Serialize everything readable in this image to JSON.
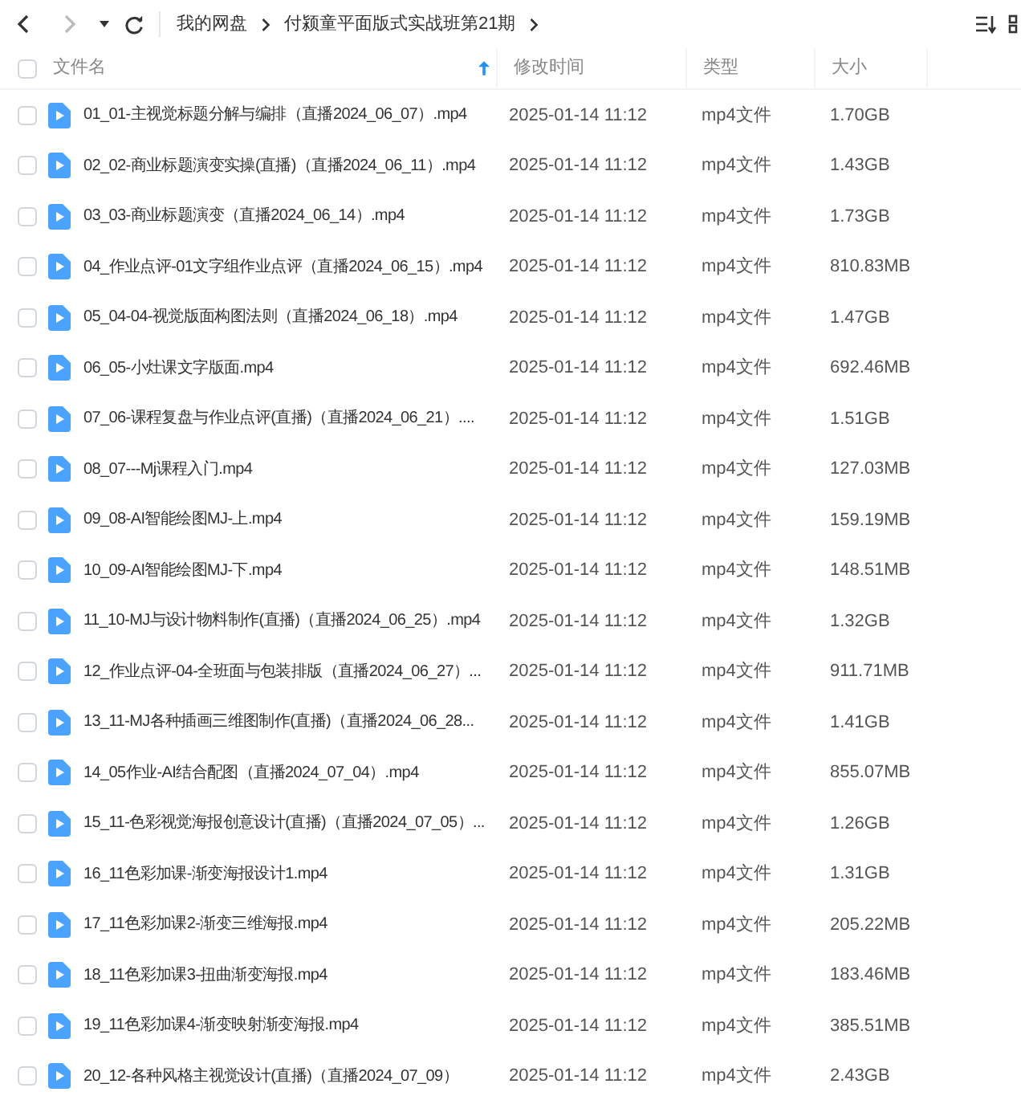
{
  "select_all": {
    "checked": false
  },
  "breadcrumb": [
    "我的网盘",
    "付颍童平面版式实战班第21期"
  ],
  "columns": [
    {
      "label": "文件名",
      "sorted": true
    },
    {
      "label": "修改时间",
      "sorted": false
    },
    {
      "label": "类型",
      "sorted": false
    },
    {
      "label": "大小",
      "sorted": false
    }
  ],
  "rows": [
    {
      "name": "01_01-主视觉标题分解与编排（直播2024_06_07）.mp4",
      "modified": "2025-01-14 11:12",
      "type": "mp4文件",
      "size": "1.70GB",
      "checked": false
    },
    {
      "name": "02_02-商业标题演变实操(直播)（直播2024_06_11）.mp4",
      "modified": "2025-01-14 11:12",
      "type": "mp4文件",
      "size": "1.43GB",
      "checked": false
    },
    {
      "name": "03_03-商业标题演变（直播2024_06_14）.mp4",
      "modified": "2025-01-14 11:12",
      "type": "mp4文件",
      "size": "1.73GB",
      "checked": false
    },
    {
      "name": "04_作业点评-01文字组作业点评（直播2024_06_15）.mp4",
      "modified": "2025-01-14 11:12",
      "type": "mp4文件",
      "size": "810.83MB",
      "checked": false
    },
    {
      "name": "05_04-04-视觉版面构图法则（直播2024_06_18）.mp4",
      "modified": "2025-01-14 11:12",
      "type": "mp4文件",
      "size": "1.47GB",
      "checked": false
    },
    {
      "name": "06_05-小灶课文字版面.mp4",
      "modified": "2025-01-14 11:12",
      "type": "mp4文件",
      "size": "692.46MB",
      "checked": false
    },
    {
      "name": "07_06-课程复盘与作业点评(直播)（直播2024_06_21）....",
      "modified": "2025-01-14 11:12",
      "type": "mp4文件",
      "size": "1.51GB",
      "checked": false
    },
    {
      "name": "08_07---Mj课程入门.mp4",
      "modified": "2025-01-14 11:12",
      "type": "mp4文件",
      "size": "127.03MB",
      "checked": false
    },
    {
      "name": "09_08-AI智能绘图MJ-上.mp4",
      "modified": "2025-01-14 11:12",
      "type": "mp4文件",
      "size": "159.19MB",
      "checked": false
    },
    {
      "name": "10_09-AI智能绘图MJ-下.mp4",
      "modified": "2025-01-14 11:12",
      "type": "mp4文件",
      "size": "148.51MB",
      "checked": false
    },
    {
      "name": "11_10-MJ与设计物料制作(直播)（直播2024_06_25）.mp4",
      "modified": "2025-01-14 11:12",
      "type": "mp4文件",
      "size": "1.32GB",
      "checked": false
    },
    {
      "name": "12_作业点评-04-全班面与包装排版（直播2024_06_27）...",
      "modified": "2025-01-14 11:12",
      "type": "mp4文件",
      "size": "911.71MB",
      "checked": false
    },
    {
      "name": "13_11-MJ各种插画三维图制作(直播)（直播2024_06_28...",
      "modified": "2025-01-14 11:12",
      "type": "mp4文件",
      "size": "1.41GB",
      "checked": false
    },
    {
      "name": "14_05作业-AI结合配图（直播2024_07_04）.mp4",
      "modified": "2025-01-14 11:12",
      "type": "mp4文件",
      "size": "855.07MB",
      "checked": false
    },
    {
      "name": "15_11-色彩视觉海报创意设计(直播)（直播2024_07_05）...",
      "modified": "2025-01-14 11:12",
      "type": "mp4文件",
      "size": "1.26GB",
      "checked": false
    },
    {
      "name": "16_11色彩加课-渐变海报设计1.mp4",
      "modified": "2025-01-14 11:12",
      "type": "mp4文件",
      "size": "1.31GB",
      "checked": false
    },
    {
      "name": "17_11色彩加课2-渐变三维海报.mp4",
      "modified": "2025-01-14 11:12",
      "type": "mp4文件",
      "size": "205.22MB",
      "checked": false
    },
    {
      "name": "18_11色彩加课3-扭曲渐变海报.mp4",
      "modified": "2025-01-14 11:12",
      "type": "mp4文件",
      "size": "183.46MB",
      "checked": false
    },
    {
      "name": "19_11色彩加课4-渐变映射渐变海报.mp4",
      "modified": "2025-01-14 11:12",
      "type": "mp4文件",
      "size": "385.51MB",
      "checked": false
    },
    {
      "name": "20_12-各种风格主视觉设计(直播)（直播2024_07_09）",
      "modified": "2025-01-14 11:12",
      "type": "mp4文件",
      "size": "2.43GB",
      "checked": false
    }
  ]
}
